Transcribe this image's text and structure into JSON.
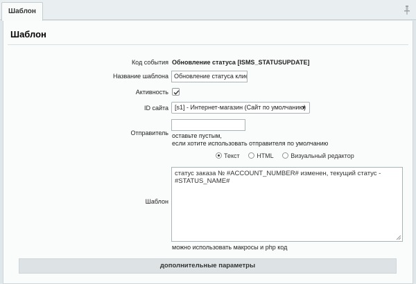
{
  "tabs": [
    {
      "label": "Шаблон",
      "active": true
    }
  ],
  "page_title": "Шаблон",
  "form": {
    "event_code": {
      "label": "Код события",
      "value": "Обновление статуса [ISMS_STATUSUPDATE]"
    },
    "template_name": {
      "label": "Название шаблона",
      "value": "Обновление статуса клиен"
    },
    "active": {
      "label": "Активность",
      "checked": true
    },
    "site_id": {
      "label": "ID сайта",
      "selected": "[s1] - Интернет-магазин (Сайт по умолчанию)"
    },
    "sender": {
      "label": "Отправитель",
      "value": "",
      "hint_line1": "оставьте пустым,",
      "hint_line2": "если хотите использовать отправителя по умолчанию"
    },
    "template": {
      "label": "Шаблон",
      "modes": [
        {
          "label": "Текст",
          "checked": true
        },
        {
          "label": "HTML",
          "checked": false
        },
        {
          "label": "Визуальный редактор",
          "checked": false
        }
      ],
      "body_line1": "статус заказа № #ACCOUNT_NUMBER# изменен, текущий статус -",
      "body_line2": "#STATUS_NAME#",
      "hint": "можно использовать макросы и php код"
    }
  },
  "extra_params_label": "дополнительные параметры"
}
